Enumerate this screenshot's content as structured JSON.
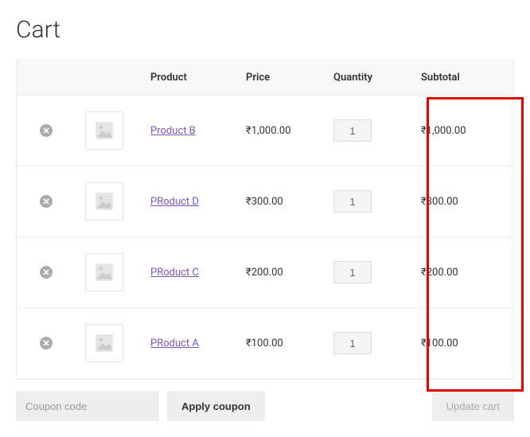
{
  "page": {
    "title": "Cart"
  },
  "headers": {
    "product": "Product",
    "price": "Price",
    "quantity": "Quantity",
    "subtotal": "Subtotal"
  },
  "items": [
    {
      "name": "Product B",
      "price": "₹1,000.00",
      "quantity": "1",
      "subtotal": "₹1,000.00"
    },
    {
      "name": "PRoduct D",
      "price": "₹300.00",
      "quantity": "1",
      "subtotal": "₹300.00"
    },
    {
      "name": "PRoduct C",
      "price": "₹200.00",
      "quantity": "1",
      "subtotal": "₹200.00"
    },
    {
      "name": "PRoduct A",
      "price": "₹100.00",
      "quantity": "1",
      "subtotal": "₹100.00"
    }
  ],
  "coupon": {
    "placeholder": "Coupon code",
    "apply_label": "Apply coupon"
  },
  "update_label": "Update cart"
}
